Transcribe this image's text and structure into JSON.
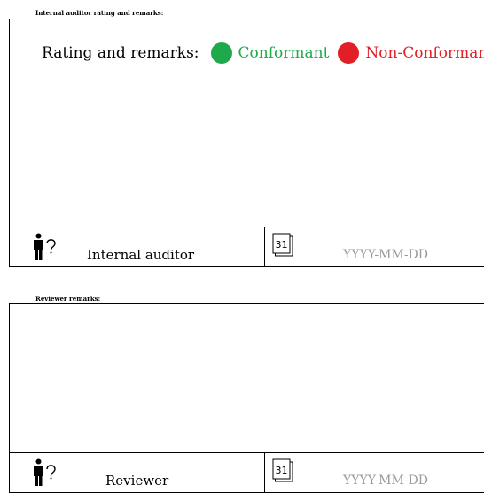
{
  "internal_section": {
    "heading": "Internal auditor rating and remarks:",
    "rating_label": "Rating and remarks:",
    "options": [
      {
        "label": "Conformant",
        "color": "#1eaa4a"
      },
      {
        "label": "Non-Conformant",
        "color": "#e21e26"
      }
    ],
    "role_label": "Internal auditor",
    "date_placeholder": "YYYY-MM-DD",
    "person_icon": "person-question-icon",
    "calendar_icon": "calendar-icon",
    "calendar_day": "31"
  },
  "reviewer_section": {
    "heading": "Reviewer remarks:",
    "role_label": "Reviewer",
    "date_placeholder": "YYYY-MM-DD",
    "person_icon": "person-question-icon",
    "calendar_icon": "calendar-icon",
    "calendar_day": "31"
  }
}
